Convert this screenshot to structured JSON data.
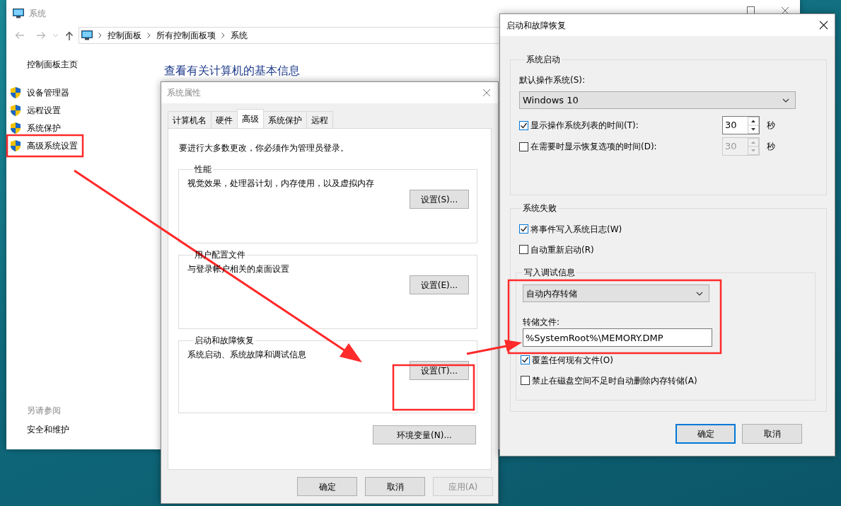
{
  "system_window": {
    "title": "系统",
    "breadcrumb": [
      "控制面板",
      "所有控制面板项",
      "系统"
    ],
    "sidebar": {
      "home": "控制面板主页",
      "items": [
        "设备管理器",
        "远程设置",
        "系统保护",
        "高级系统设置"
      ],
      "see_also_heading": "另请参阅",
      "see_also": [
        "安全和维护"
      ]
    },
    "heading": "查看有关计算机的基本信息"
  },
  "properties_dialog": {
    "title": "系统属性",
    "tabs": [
      {
        "label": "计算机名",
        "selected": false
      },
      {
        "label": "硬件",
        "selected": false
      },
      {
        "label": "高级",
        "selected": true
      },
      {
        "label": "系统保护",
        "selected": false
      },
      {
        "label": "远程",
        "selected": false
      }
    ],
    "notice": "要进行大多数更改，你必须作为管理员登录。",
    "groups": [
      {
        "title": "性能",
        "description": "视觉效果，处理器计划，内存使用，以及虚拟内存",
        "button": "设置(S)..."
      },
      {
        "title": "用户配置文件",
        "description": "与登录帐户相关的桌面设置",
        "button": "设置(E)..."
      },
      {
        "title": "启动和故障恢复",
        "description": "系统启动、系统故障和调试信息",
        "button": "设置(T)..."
      }
    ],
    "env_button": "环境变量(N)...",
    "buttons": [
      {
        "label": "确定",
        "disabled": false
      },
      {
        "label": "取消",
        "disabled": false
      },
      {
        "label": "应用(A)",
        "disabled": true
      }
    ]
  },
  "recovery_dialog": {
    "title": "启动和故障恢复",
    "startup": {
      "title": "系统启动",
      "os_label": "默认操作系统(S):",
      "os_value": "Windows 10",
      "timers": [
        {
          "label": "显示操作系统列表的时间(T):",
          "checked": true,
          "value": "30",
          "unit": "秒",
          "disabled": false
        },
        {
          "label": "在需要时显示恢复选项的时间(D):",
          "checked": false,
          "value": "30",
          "unit": "秒",
          "disabled": true
        }
      ]
    },
    "failure": {
      "title": "系统失败",
      "checks": [
        {
          "label": "将事件写入系统日志(W)",
          "checked": true
        },
        {
          "label": "自动重新启动(R)",
          "checked": false
        }
      ],
      "debug": {
        "title": "写入调试信息",
        "dump_type": "自动内存转储",
        "file_label": "转储文件:",
        "file_value": "%SystemRoot%\\MEMORY.DMP",
        "checks": [
          {
            "label": "覆盖任何现有文件(O)",
            "checked": true
          },
          {
            "label": "禁止在磁盘空间不足时自动删除内存转储(A)",
            "checked": false
          }
        ]
      }
    },
    "buttons": [
      {
        "label": "确定",
        "default": true
      },
      {
        "label": "取消",
        "default": false
      }
    ]
  }
}
